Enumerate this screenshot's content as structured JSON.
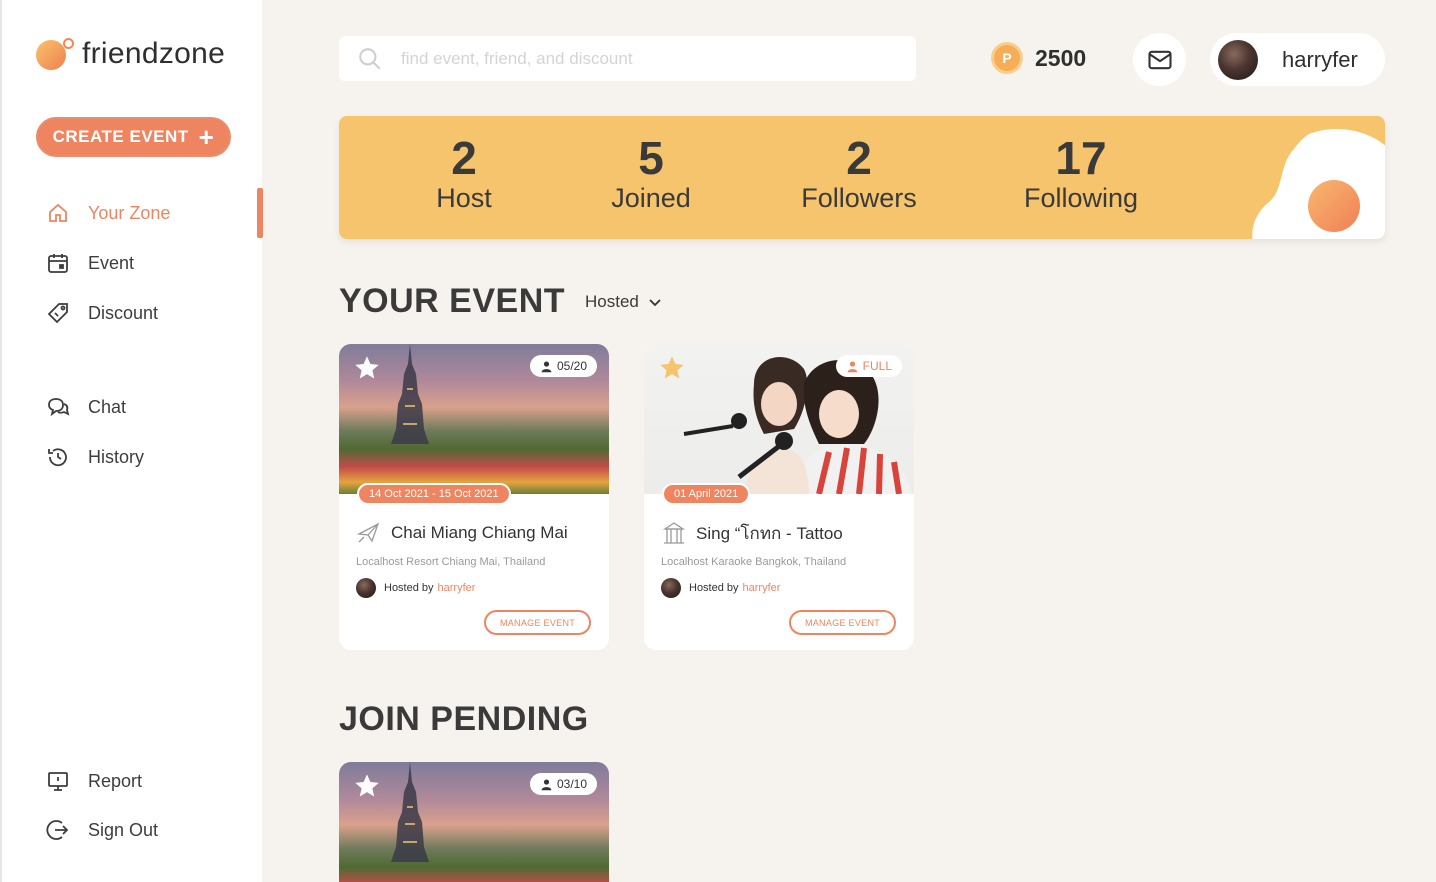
{
  "app": {
    "name": "friendzone"
  },
  "sidebar": {
    "create_label": "CREATE EVENT",
    "items": [
      {
        "label": "Your Zone",
        "icon": "home-icon",
        "active": true
      },
      {
        "label": "Event",
        "icon": "calendar-icon"
      },
      {
        "label": "Discount",
        "icon": "tag-icon"
      },
      {
        "label": "Chat",
        "icon": "chat-icon"
      },
      {
        "label": "History",
        "icon": "history-icon"
      },
      {
        "label": "Report",
        "icon": "monitor-icon"
      },
      {
        "label": "Sign Out",
        "icon": "sign-out-icon"
      }
    ]
  },
  "header": {
    "search_placeholder": "find event, friend, and discount",
    "points": "2500",
    "coin_letter": "P",
    "username": "harryfer"
  },
  "stats": [
    {
      "value": "2",
      "label": "Host"
    },
    {
      "value": "5",
      "label": "Joined"
    },
    {
      "value": "2",
      "label": "Followers"
    },
    {
      "value": "17",
      "label": "Following"
    }
  ],
  "your_event": {
    "title": "YOUR EVENT",
    "filter": "Hosted",
    "cards": [
      {
        "capacity": "05/20",
        "date": "14 Oct 2021 - 15 Oct 2021",
        "title": "Chai Miang Chiang Mai",
        "location": "Localhost Resort Chiang Mai, Thailand",
        "hosted_by": "Hosted by",
        "host": "harryfer",
        "manage": "MANAGE EVENT",
        "starred": false,
        "category_icon": "plane-icon"
      },
      {
        "capacity": "FULL",
        "date": "01 April 2021",
        "title": "Sing “โกทก - Tattoo",
        "location": "Localhost Karaoke Bangkok, Thailand",
        "hosted_by": "Hosted by",
        "host": "harryfer",
        "manage": "MANAGE EVENT",
        "starred": true,
        "category_icon": "karaoke-icon"
      }
    ]
  },
  "join_pending": {
    "title": "JOIN PENDING",
    "cards": [
      {
        "capacity": "03/10",
        "starred": false
      }
    ]
  },
  "colors": {
    "accent": "#ef8560",
    "banner": "#f6c46c",
    "background": "#f6f3ee"
  }
}
